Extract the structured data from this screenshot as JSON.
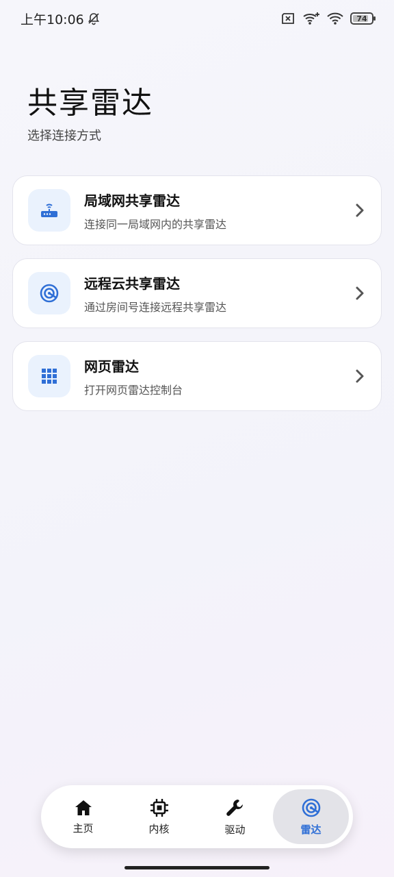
{
  "status_bar": {
    "time": "上午10:06",
    "battery": "74"
  },
  "header": {
    "title": "共享雷达",
    "subtitle": "选择连接方式"
  },
  "options": [
    {
      "title": "局域网共享雷达",
      "desc": "连接同一局域网内的共享雷达",
      "icon": "router-icon"
    },
    {
      "title": "远程云共享雷达",
      "desc": "通过房间号连接远程共享雷达",
      "icon": "radar-icon"
    },
    {
      "title": "网页雷达",
      "desc": "打开网页雷达控制台",
      "icon": "grid-icon"
    }
  ],
  "bottom_nav": {
    "items": [
      {
        "label": "主页",
        "icon": "home-icon"
      },
      {
        "label": "内核",
        "icon": "chip-icon"
      },
      {
        "label": "驱动",
        "icon": "wrench-icon"
      },
      {
        "label": "雷达",
        "icon": "radar-icon",
        "active": true
      }
    ]
  },
  "colors": {
    "accent": "#2f6fd6",
    "icon_bg": "#eaf2fd",
    "active_tab_bg": "#e3e3e8"
  }
}
